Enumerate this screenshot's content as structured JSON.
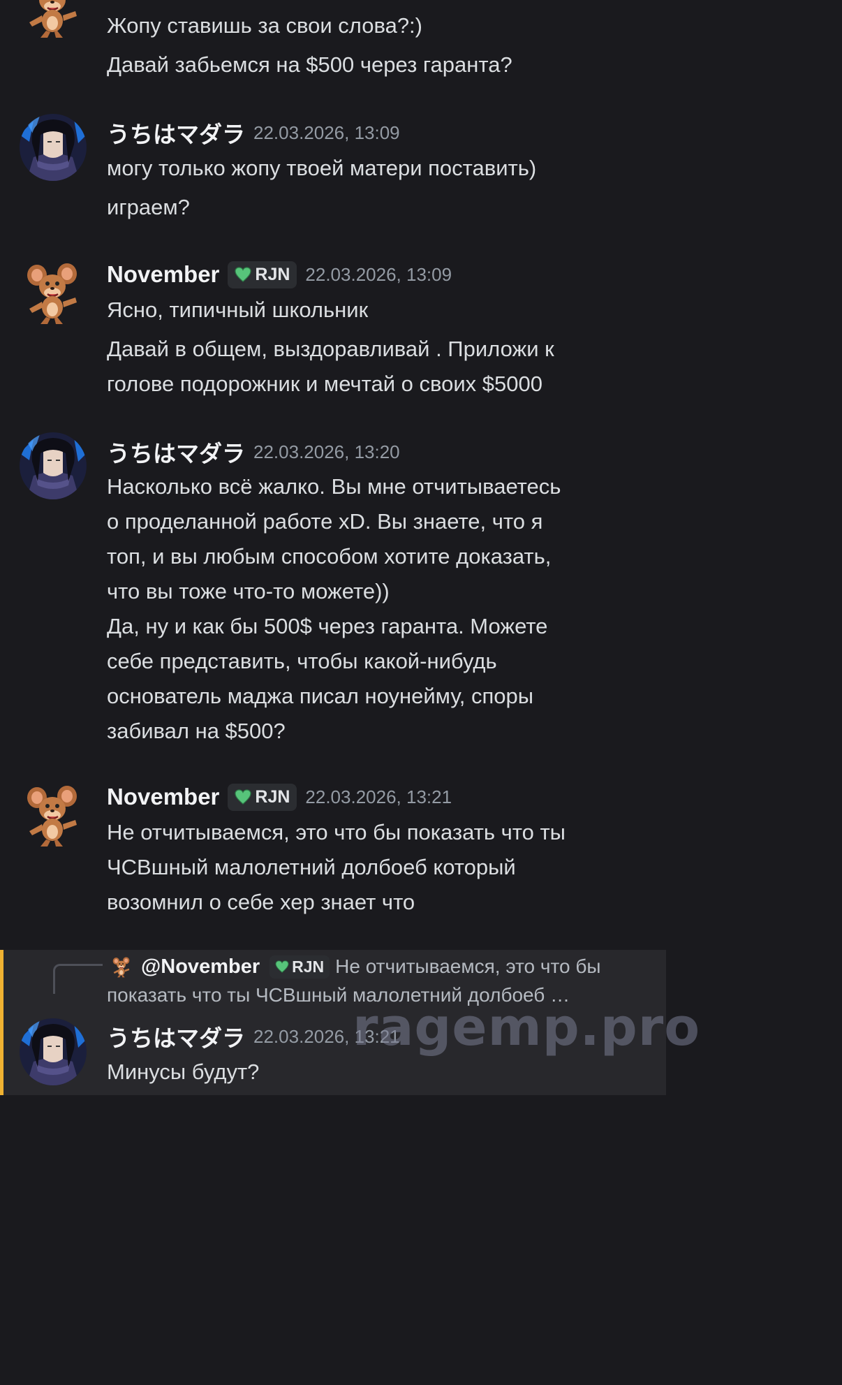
{
  "colors": {
    "background": "#1a1a1e",
    "role_heart": "#57c47a",
    "reply_accent": "#f0b232"
  },
  "messages": [
    {
      "author": "",
      "lines": [
        "Жопу ставишь за свои слова?:)",
        "Давай забьемся на $500 через гаранта?"
      ]
    },
    {
      "author": "うちはマダラ",
      "time": "22.03.2026, 13:09",
      "lines": [
        "могу только жопу твоей матери поставить)",
        "играем?"
      ]
    },
    {
      "author": "November",
      "tag": "RJN",
      "time": "22.03.2026, 13:09",
      "lines": [
        "Ясно, типичный школьник",
        "Давай в общем, выздоравливай . Приложи к",
        "голове подорожник и мечтай о своих $5000"
      ]
    },
    {
      "author": "うちはマダラ",
      "time": "22.03.2026, 13:20",
      "lines": [
        "Насколько всё жалко. Вы мне отчитываетесь",
        "о проделанной работе xD. Вы знаете, что я",
        "топ, и вы любым способом хотите доказать,",
        "что вы тоже что-то можете))",
        "Да, ну и как бы 500$ через гаранта. Можете",
        "себе представить, чтобы какой-нибудь",
        "основатель маджа писал ноунейму, споры",
        "забивал на $500?"
      ]
    },
    {
      "author": "November",
      "tag": "RJN",
      "time": "22.03.2026, 13:21",
      "lines": [
        "Не отчитываемся, это что бы показать что ты",
        "ЧСВшный малолетний долбоеб который",
        "возомнил о себе хер знает что"
      ]
    },
    {
      "author": "うちはマダラ",
      "time": "22.03.2026, 13:21",
      "reply": {
        "author": "@November",
        "tag": "RJN",
        "text_line1": "Не отчитываемся, это что бы",
        "text_line2": "показать что ты ЧСВшный малолетний долбоеб …"
      },
      "lines": [
        "Минусы будут?"
      ]
    }
  ],
  "watermark": "ragemp.pro",
  "icons": {
    "role": "green-heart-icon",
    "avatar_a": "cartoon-mouse-avatar",
    "avatar_b": "anime-character-avatar"
  }
}
